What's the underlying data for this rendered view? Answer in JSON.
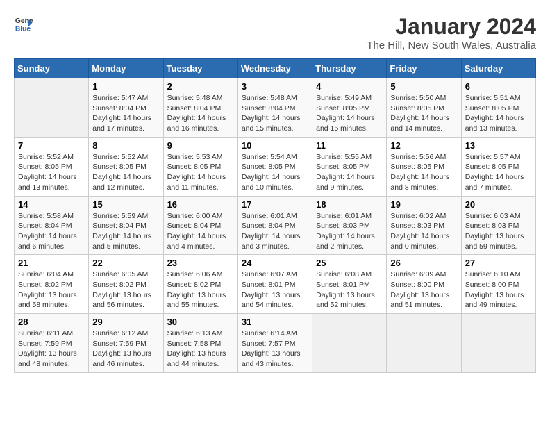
{
  "header": {
    "logo_line1": "General",
    "logo_line2": "Blue",
    "main_title": "January 2024",
    "sub_title": "The Hill, New South Wales, Australia"
  },
  "days_of_week": [
    "Sunday",
    "Monday",
    "Tuesday",
    "Wednesday",
    "Thursday",
    "Friday",
    "Saturday"
  ],
  "weeks": [
    [
      {
        "day": "",
        "info": ""
      },
      {
        "day": "1",
        "info": "Sunrise: 5:47 AM\nSunset: 8:04 PM\nDaylight: 14 hours\nand 17 minutes."
      },
      {
        "day": "2",
        "info": "Sunrise: 5:48 AM\nSunset: 8:04 PM\nDaylight: 14 hours\nand 16 minutes."
      },
      {
        "day": "3",
        "info": "Sunrise: 5:48 AM\nSunset: 8:04 PM\nDaylight: 14 hours\nand 15 minutes."
      },
      {
        "day": "4",
        "info": "Sunrise: 5:49 AM\nSunset: 8:05 PM\nDaylight: 14 hours\nand 15 minutes."
      },
      {
        "day": "5",
        "info": "Sunrise: 5:50 AM\nSunset: 8:05 PM\nDaylight: 14 hours\nand 14 minutes."
      },
      {
        "day": "6",
        "info": "Sunrise: 5:51 AM\nSunset: 8:05 PM\nDaylight: 14 hours\nand 13 minutes."
      }
    ],
    [
      {
        "day": "7",
        "info": "Sunrise: 5:52 AM\nSunset: 8:05 PM\nDaylight: 14 hours\nand 13 minutes."
      },
      {
        "day": "8",
        "info": "Sunrise: 5:52 AM\nSunset: 8:05 PM\nDaylight: 14 hours\nand 12 minutes."
      },
      {
        "day": "9",
        "info": "Sunrise: 5:53 AM\nSunset: 8:05 PM\nDaylight: 14 hours\nand 11 minutes."
      },
      {
        "day": "10",
        "info": "Sunrise: 5:54 AM\nSunset: 8:05 PM\nDaylight: 14 hours\nand 10 minutes."
      },
      {
        "day": "11",
        "info": "Sunrise: 5:55 AM\nSunset: 8:05 PM\nDaylight: 14 hours\nand 9 minutes."
      },
      {
        "day": "12",
        "info": "Sunrise: 5:56 AM\nSunset: 8:05 PM\nDaylight: 14 hours\nand 8 minutes."
      },
      {
        "day": "13",
        "info": "Sunrise: 5:57 AM\nSunset: 8:05 PM\nDaylight: 14 hours\nand 7 minutes."
      }
    ],
    [
      {
        "day": "14",
        "info": "Sunrise: 5:58 AM\nSunset: 8:04 PM\nDaylight: 14 hours\nand 6 minutes."
      },
      {
        "day": "15",
        "info": "Sunrise: 5:59 AM\nSunset: 8:04 PM\nDaylight: 14 hours\nand 5 minutes."
      },
      {
        "day": "16",
        "info": "Sunrise: 6:00 AM\nSunset: 8:04 PM\nDaylight: 14 hours\nand 4 minutes."
      },
      {
        "day": "17",
        "info": "Sunrise: 6:01 AM\nSunset: 8:04 PM\nDaylight: 14 hours\nand 3 minutes."
      },
      {
        "day": "18",
        "info": "Sunrise: 6:01 AM\nSunset: 8:03 PM\nDaylight: 14 hours\nand 2 minutes."
      },
      {
        "day": "19",
        "info": "Sunrise: 6:02 AM\nSunset: 8:03 PM\nDaylight: 14 hours\nand 0 minutes."
      },
      {
        "day": "20",
        "info": "Sunrise: 6:03 AM\nSunset: 8:03 PM\nDaylight: 13 hours\nand 59 minutes."
      }
    ],
    [
      {
        "day": "21",
        "info": "Sunrise: 6:04 AM\nSunset: 8:02 PM\nDaylight: 13 hours\nand 58 minutes."
      },
      {
        "day": "22",
        "info": "Sunrise: 6:05 AM\nSunset: 8:02 PM\nDaylight: 13 hours\nand 56 minutes."
      },
      {
        "day": "23",
        "info": "Sunrise: 6:06 AM\nSunset: 8:02 PM\nDaylight: 13 hours\nand 55 minutes."
      },
      {
        "day": "24",
        "info": "Sunrise: 6:07 AM\nSunset: 8:01 PM\nDaylight: 13 hours\nand 54 minutes."
      },
      {
        "day": "25",
        "info": "Sunrise: 6:08 AM\nSunset: 8:01 PM\nDaylight: 13 hours\nand 52 minutes."
      },
      {
        "day": "26",
        "info": "Sunrise: 6:09 AM\nSunset: 8:00 PM\nDaylight: 13 hours\nand 51 minutes."
      },
      {
        "day": "27",
        "info": "Sunrise: 6:10 AM\nSunset: 8:00 PM\nDaylight: 13 hours\nand 49 minutes."
      }
    ],
    [
      {
        "day": "28",
        "info": "Sunrise: 6:11 AM\nSunset: 7:59 PM\nDaylight: 13 hours\nand 48 minutes."
      },
      {
        "day": "29",
        "info": "Sunrise: 6:12 AM\nSunset: 7:59 PM\nDaylight: 13 hours\nand 46 minutes."
      },
      {
        "day": "30",
        "info": "Sunrise: 6:13 AM\nSunset: 7:58 PM\nDaylight: 13 hours\nand 44 minutes."
      },
      {
        "day": "31",
        "info": "Sunrise: 6:14 AM\nSunset: 7:57 PM\nDaylight: 13 hours\nand 43 minutes."
      },
      {
        "day": "",
        "info": ""
      },
      {
        "day": "",
        "info": ""
      },
      {
        "day": "",
        "info": ""
      }
    ]
  ]
}
